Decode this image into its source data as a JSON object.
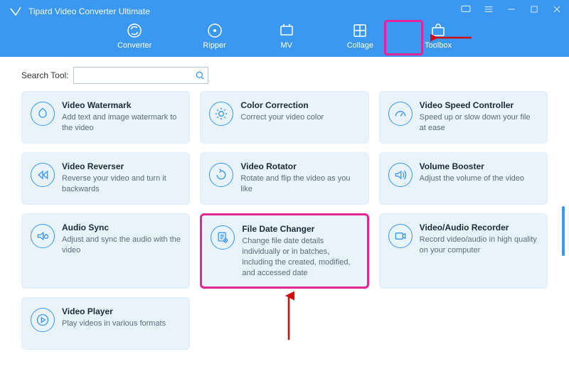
{
  "app": {
    "title": "Tipard Video Converter Ultimate"
  },
  "tabs": [
    {
      "label": "Converter"
    },
    {
      "label": "Ripper"
    },
    {
      "label": "MV"
    },
    {
      "label": "Collage"
    },
    {
      "label": "Toolbox"
    }
  ],
  "search": {
    "label": "Search Tool:",
    "value": ""
  },
  "tools": [
    {
      "title": "Video Watermark",
      "desc": "Add text and image watermark to the video"
    },
    {
      "title": "Color Correction",
      "desc": "Correct your video color"
    },
    {
      "title": "Video Speed Controller",
      "desc": "Speed up or slow down your file at ease"
    },
    {
      "title": "Video Reverser",
      "desc": "Reverse your video and turn it backwards"
    },
    {
      "title": "Video Rotator",
      "desc": "Rotate and flip the video as you like"
    },
    {
      "title": "Volume Booster",
      "desc": "Adjust the volume of the video"
    },
    {
      "title": "Audio Sync",
      "desc": "Adjust and sync the audio with the video"
    },
    {
      "title": "File Date Changer",
      "desc": "Change file date details individually or in batches, including the created, modified, and accessed date"
    },
    {
      "title": "Video/Audio Recorder",
      "desc": "Record video/audio in high quality on your computer"
    },
    {
      "title": "Video Player",
      "desc": "Play videos in various formats"
    }
  ],
  "colors": {
    "accent": "#3a98f0",
    "cardBg": "#e9f3fc",
    "highlight": "#e22696"
  }
}
